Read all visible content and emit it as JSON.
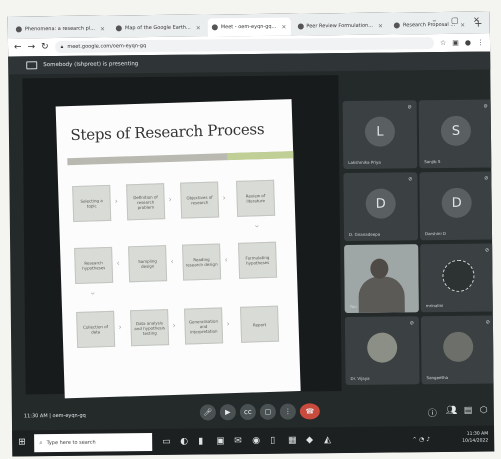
{
  "browser": {
    "tabs": [
      {
        "label": "Phenomena: a research pl...",
        "active": false
      },
      {
        "label": "Map of the Google Earth...",
        "active": false
      },
      {
        "label": "Meet - oem-eyqn-gq...",
        "active": true
      },
      {
        "label": "Peer Review Formulation...",
        "active": false
      },
      {
        "label": "Research Proposal ...",
        "active": false
      }
    ],
    "url": "meet.google.com/oem-eyqn-gq"
  },
  "meet": {
    "share_text": "Somebody (Ishpreet) is presenting",
    "meeting_time": "11:30 AM",
    "meeting_code": "oem-eyqn-gq",
    "slide": {
      "title": "Steps of Research Process",
      "steps": [
        "Selecting a topic",
        "Definition of research problem",
        "Objectives of research",
        "Review of literature",
        "Research hypotheses",
        "Sampling design",
        "Reading research design",
        "Formulating hypotheses",
        "Collection of data",
        "Data analysis and hypothesis testing",
        "Generalisation and interpretation",
        "Report"
      ]
    },
    "participants": [
      {
        "initial": "L",
        "name": "Lakshmika Priya"
      },
      {
        "initial": "S",
        "name": "Sanjib S"
      },
      {
        "initial": "D",
        "name": "D. Gnanadeepa"
      },
      {
        "initial": "D",
        "name": "Darshini D"
      },
      {
        "initial": "",
        "name": "You"
      },
      {
        "initial": "",
        "name": "mrinalini"
      },
      {
        "initial": "",
        "name": "Dr. Vijaya"
      },
      {
        "initial": "",
        "name": "Sangeetha"
      }
    ]
  },
  "taskbar": {
    "search_placeholder": "Type here to search",
    "time": "11:30 AM",
    "date": "10/14/2022"
  }
}
